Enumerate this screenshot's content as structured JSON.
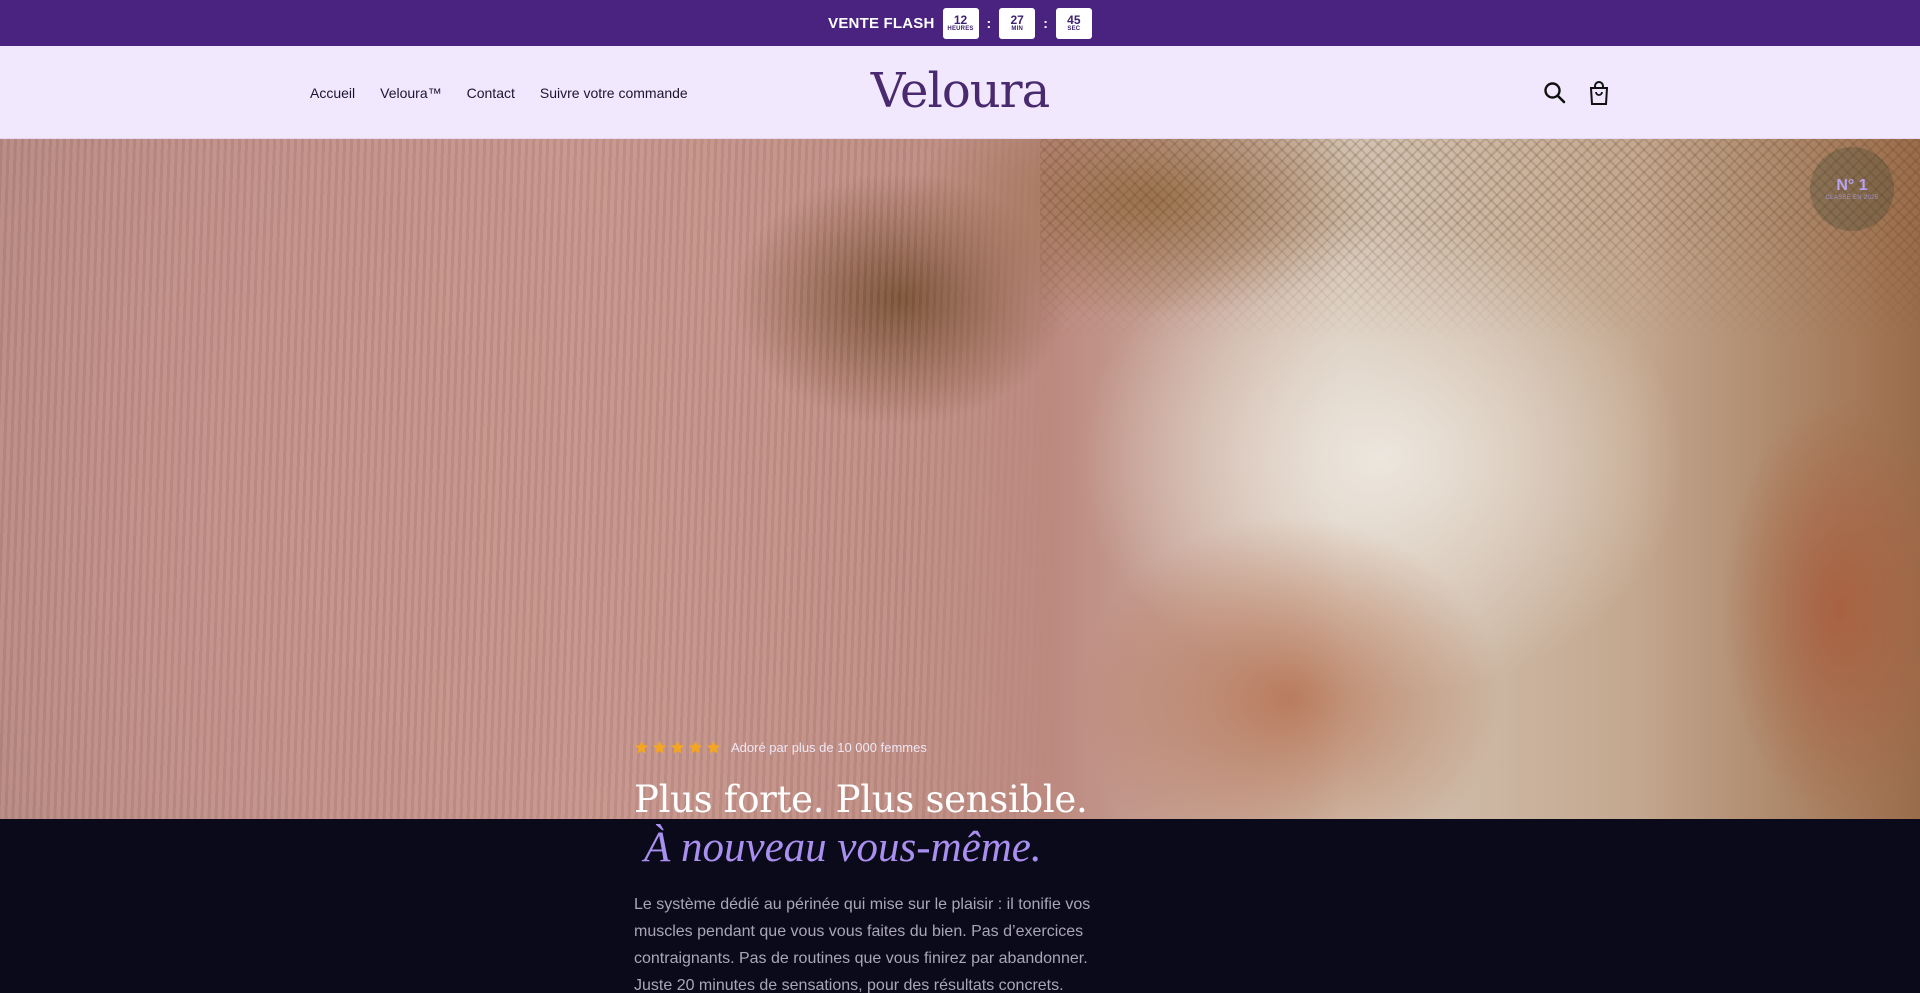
{
  "announcement": {
    "label": "VENTE FLASH",
    "countdown": [
      {
        "value": "12",
        "unit": "HEURES"
      },
      {
        "value": "27",
        "unit": "MIN"
      },
      {
        "value": "45",
        "unit": "SEC"
      }
    ],
    "separator": ":"
  },
  "nav": {
    "items": [
      "Accueil",
      "Veloura™",
      "Contact",
      "Suivre votre commande"
    ]
  },
  "brand": {
    "logo_text": "Veloura"
  },
  "icons": {
    "search": "search-icon",
    "cart": "shopping-bag-icon"
  },
  "hero": {
    "badge": {
      "title": "N° 1",
      "subtitle": "CLASSÉ EN 2025"
    },
    "rating": {
      "stars": 5,
      "text": "Adoré par plus de 10 000 femmes"
    },
    "headline_line1": "Plus forte. Plus sensible.",
    "headline_line2": "À nouveau vous-même.",
    "description": "Le système dédié au périnée qui mise sur le plaisir : il tonifie vos muscles pendant que vous vous faites du bien. Pas d’exercices contraignants. Pas de routines que vous finirez par abandonner. Juste 20 minutes de sensations, pour des résultats concrets."
  },
  "colors": {
    "announcement_bg": "#4a2280",
    "header_bg": "#f1e8fd",
    "accent": "#a98ff0",
    "star": "#f4a623",
    "dark_bg": "#0b0a1a"
  }
}
